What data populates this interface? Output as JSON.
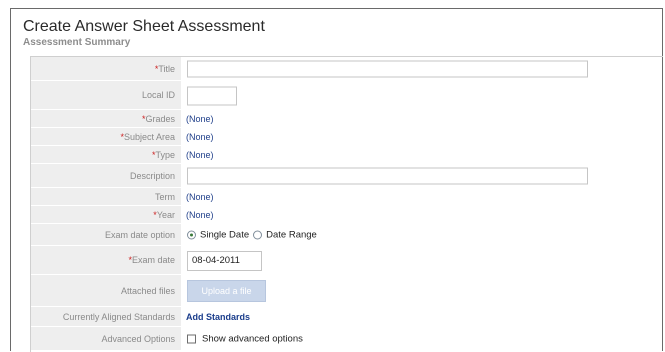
{
  "page": {
    "title": "Create Answer Sheet Assessment",
    "section": "Assessment Summary"
  },
  "fields": {
    "title": {
      "required": "*",
      "label": "Title",
      "value": ""
    },
    "local_id": {
      "label": "Local ID",
      "value": ""
    },
    "grades": {
      "required": "*",
      "label": "Grades",
      "value": "(None)"
    },
    "subject_area": {
      "required": "*",
      "label": "Subject Area",
      "value": "(None)"
    },
    "type": {
      "required": "*",
      "label": "Type",
      "value": "(None)"
    },
    "description": {
      "label": "Description",
      "value": ""
    },
    "term": {
      "label": "Term",
      "value": "(None)"
    },
    "year": {
      "required": "*",
      "label": "Year",
      "value": "(None)"
    },
    "exam_date_option": {
      "label": "Exam date option",
      "options": [
        "Single Date",
        "Date Range"
      ],
      "selected": "Single Date"
    },
    "exam_date": {
      "required": "*",
      "label": "Exam date",
      "value": "08-04-2011"
    },
    "attached_files": {
      "label": "Attached files",
      "button": "Upload a file"
    },
    "aligned_standards": {
      "label": "Currently Aligned Standards",
      "link": "Add Standards"
    },
    "advanced_options": {
      "label": "Advanced Options",
      "checkbox_label": "Show advanced options",
      "checked": false
    }
  },
  "colors": {
    "required": "#cc2222",
    "link": "#1f3f8a",
    "label_bg": "#eeeeee",
    "upload_bg": "#c9d6ea"
  }
}
